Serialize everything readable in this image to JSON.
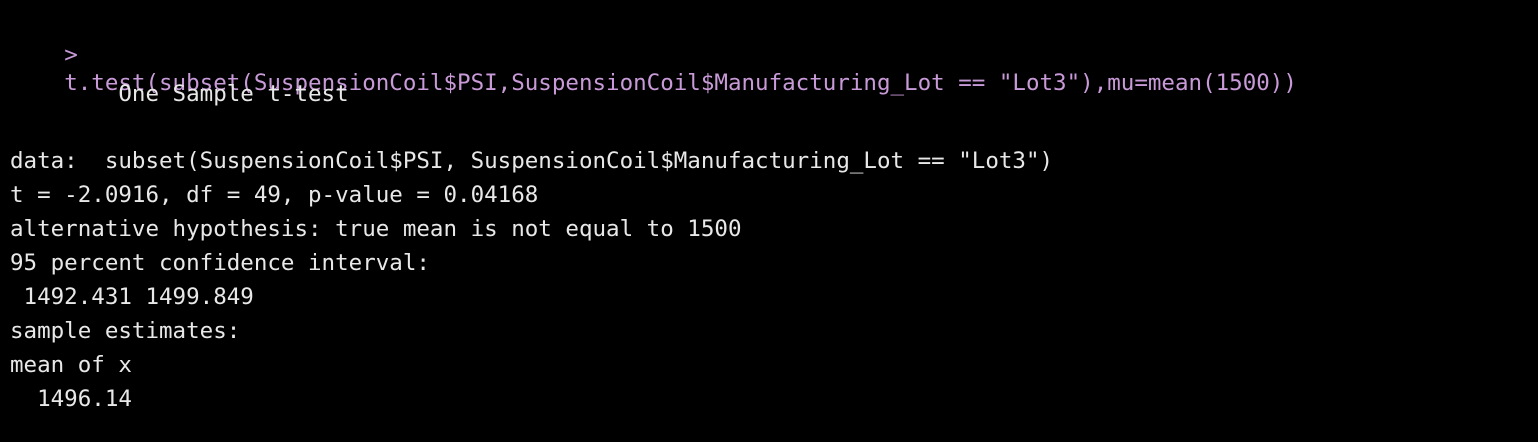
{
  "console": {
    "prompt": ">",
    "command": "t.test(subset(SuspensionCoil$PSI,SuspensionCoil$Manufacturing_Lot == \"Lot3\"),mu=mean(1500))",
    "output": {
      "title": "        One Sample t-test",
      "data_line": "data:  subset(SuspensionCoil$PSI, SuspensionCoil$Manufacturing_Lot == \"Lot3\")",
      "stats_line": "t = -2.0916, df = 49, p-value = 0.04168",
      "alt_hypothesis": "alternative hypothesis: true mean is not equal to 1500",
      "ci_label": "95 percent confidence interval:",
      "ci_values": " 1492.431 1499.849",
      "estimates_label": "sample estimates:",
      "estimate_name": "mean of x",
      "estimate_value": "  1496.14"
    },
    "colors": {
      "background": "#000000",
      "command": "#c89ad8",
      "output": "#e8e8e8"
    }
  }
}
